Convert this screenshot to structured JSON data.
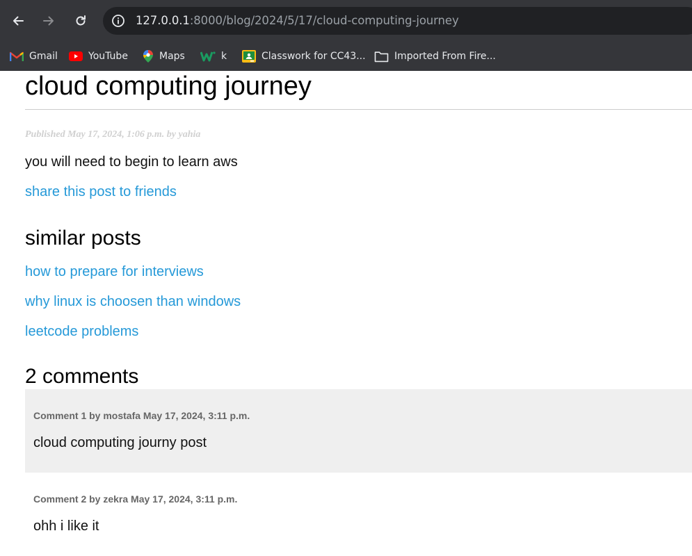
{
  "browser": {
    "url_host": "127.0.0.1",
    "url_rest": ":8000/blog/2024/5/17/cloud-computing-journey",
    "bookmarks": [
      {
        "label": "Gmail",
        "icon": "gmail-icon"
      },
      {
        "label": "YouTube",
        "icon": "youtube-icon"
      },
      {
        "label": "Maps",
        "icon": "maps-icon"
      },
      {
        "label": "k",
        "icon": "w-icon"
      },
      {
        "label": "Classwork for CC43...",
        "icon": "classroom-icon"
      },
      {
        "label": "Imported From Fire...",
        "icon": "folder-icon"
      }
    ]
  },
  "post": {
    "title": "cloud computing journey",
    "meta": "Published May 17, 2024, 1:06 p.m. by yahia",
    "body": "you will need to begin to learn aws",
    "share_link": "share this post to friends"
  },
  "similar": {
    "heading": "similar posts",
    "posts": [
      "how to prepare for interviews",
      "why linux is choosen than windows",
      "leetcode problems"
    ]
  },
  "comments": {
    "heading": "2 comments",
    "items": [
      {
        "info": "Comment 1 by mostafa May 17, 2024, 3:11 p.m.",
        "text": "cloud computing journy post"
      },
      {
        "info": "Comment 2 by zekra May 17, 2024, 3:11 p.m.",
        "text": "ohh i like it"
      }
    ]
  },
  "colors": {
    "chrome": "#35363a",
    "omnibox": "#202124",
    "link": "#2599d8",
    "comment_bg": "#efefef"
  }
}
